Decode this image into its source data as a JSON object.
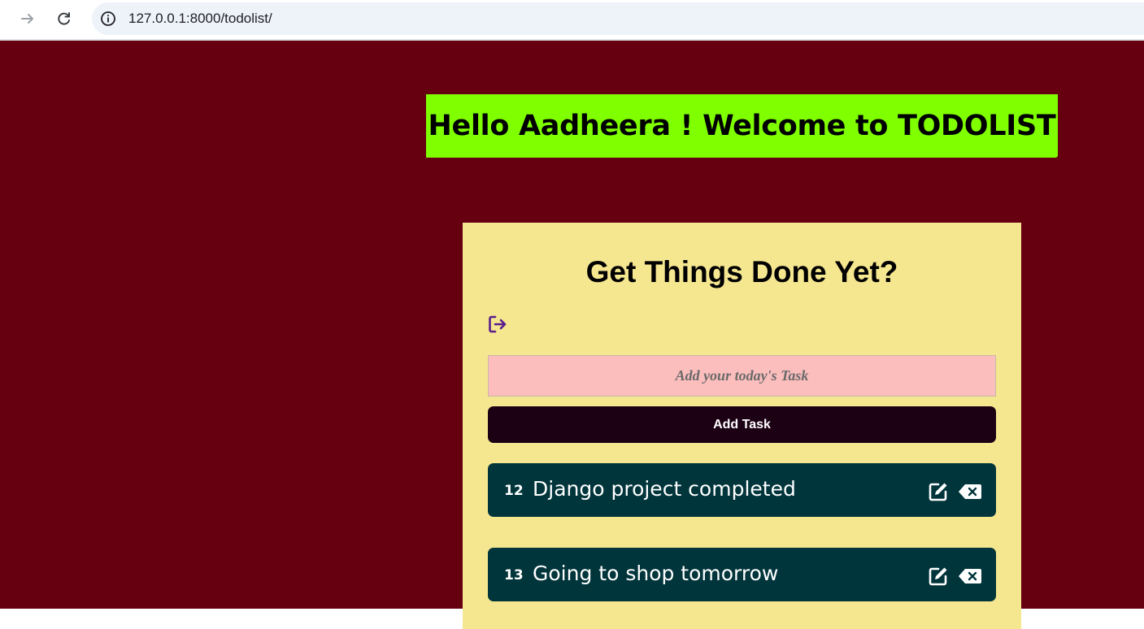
{
  "browser": {
    "url": "127.0.0.1:8000/todolist/"
  },
  "header": {
    "greeting": "Hello Aadheera ! Welcome to TODOLIST"
  },
  "card": {
    "title": "Get Things Done Yet?",
    "input_placeholder": "Add your today's Task",
    "add_button_label": "Add Task"
  },
  "tasks": [
    {
      "id": "12",
      "text": "Django project completed"
    },
    {
      "id": "13",
      "text": "Going to shop tomorrow"
    }
  ],
  "colors": {
    "page_bg": "#660010",
    "greeting_bg": "#7fff00",
    "card_bg": "#f5e690",
    "input_bg": "#fcbdbd",
    "button_bg": "#1c0014",
    "task_bg": "#00353b",
    "logout_icon": "#5a1f8c"
  },
  "icons": {
    "logout": "logout-icon",
    "edit": "edit-icon",
    "delete": "backspace-delete-icon"
  }
}
